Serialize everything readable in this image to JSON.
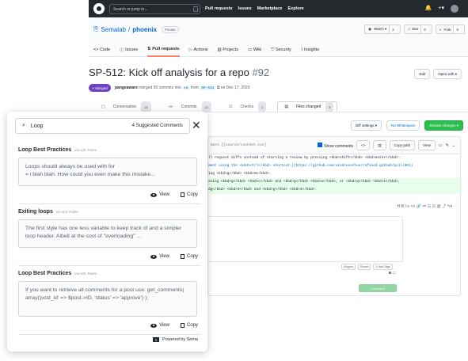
{
  "github": {
    "search_placeholder": "Search or jump to...",
    "slash_key": "/",
    "nav": [
      "Pull requests",
      "Issues",
      "Marketplace",
      "Explore"
    ],
    "repo": {
      "owner": "Semalab",
      "sep": " / ",
      "name": "phoenix",
      "visibility": "Private"
    },
    "repo_buttons": {
      "watch": "Watch ▾",
      "watch_count": "2",
      "star": "☆ Star",
      "star_count": "0",
      "fork": "Fork",
      "fork_count": "0"
    },
    "tabs": [
      "<> Code",
      "Issues",
      "Pull requests",
      "Actions",
      "Projects",
      "Wiki",
      "Security",
      "Insights"
    ],
    "pr": {
      "title": "SP-512: Kick off analysis for a repo",
      "number": "#92",
      "edit": "Edit",
      "open_with": "Open with ▾",
      "status": "Merged",
      "user": "pangeaware",
      "merge_text_1": "merged 20 commits into",
      "base": "sa",
      "merge_text_2": "from",
      "head": "SP-512",
      "merge_text_3": "on Dec 17, 2020"
    },
    "pr_tabs": {
      "conversation": "Conversation",
      "conversation_count": "25",
      "commits": "Commits",
      "commits_count": "15",
      "checks": "Checks",
      "checks_count": "0",
      "files": "Files changed",
      "files_count": "3"
    },
    "toolbar": {
      "diff_settings": "Diff settings ▾",
      "whitespace": "No Whitespace",
      "review": "Review changes ▾"
    },
    "file": {
      "path": "mare.[[source/content.css]",
      "show_comments": "Show comments",
      "copy_path": "Copy path",
      "view": "View"
    },
    "code_lines": [
      "ll request diffs instead of starting a review by pressing <kbd>shift</kbd> <kbd>enter</kbd>.",
      "ment using the <kbd>ctrl</kbd> shortcut.](https://github.com/sindresorhus/refined-github/pull/961)",
      "ing <kbd>g</kbd> <kbd>m</kbd>.",
      "ssing <kbd>g</kbd> <kbd>c</kbd> and <kbd>g</kbd> <kbd>a</kbd>, or <kbd>g</kbd> <kbd>1</kbd>,",
      "dg</kbd> <kbd>3</kbd> and <kbd>g</kbd> <kbd>4</kbd>."
    ],
    "editor_tools": "H  B  I  ≡  <>  🔗   ≔  ☷  ☑   @  ⤴  ↰▾",
    "chips": [
      "Muguet",
      "Shovel",
      "✎ Add Tags"
    ],
    "comment_button": "Comment"
  },
  "panel": {
    "query": "Loop",
    "count_label": "4 Suggested Comments",
    "close": "✕",
    "suggestions": [
      {
        "title": "Loop Best Practices",
        "via": "via w3c Rules",
        "body": "Loops should always be used with for\n= i blah blah. How could you even make this mistake...",
        "view": "View",
        "copy": "Copy"
      },
      {
        "title": "Exiting loops",
        "via": "via w3c Rules",
        "body": "The first style has one less variable to keep track of and a simpler loop header. Albeit at the cost of \"overloading\" ...",
        "view": "View",
        "copy": "Copy"
      },
      {
        "title": "Loop Best Practices",
        "via": "via w3c Rules",
        "body": "If you want to retrieve all comments for a post use: get_comments( array('post_id' => $post->ID, 'status' => 'approve') );",
        "view": "View",
        "copy": "Copy"
      }
    ],
    "powered_by": "Powered by Sema",
    "sema_logo": "S"
  }
}
